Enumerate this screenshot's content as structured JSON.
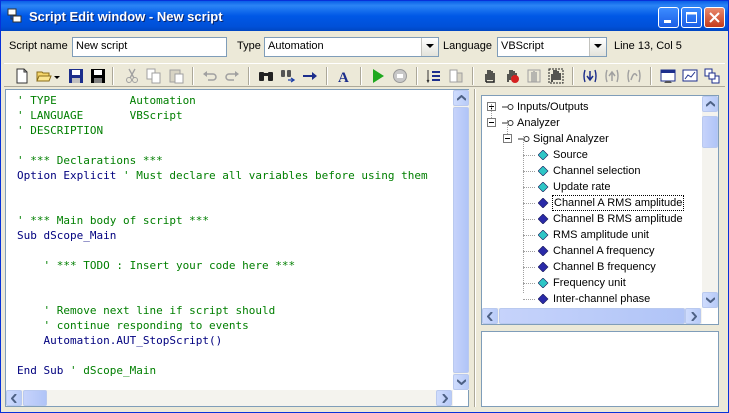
{
  "window": {
    "title": "Script Edit window - New script",
    "icon": "script-app-icon",
    "controls": [
      "minimize-icon",
      "maximize-icon",
      "close-icon"
    ]
  },
  "options": {
    "script_name_label": "Script name",
    "script_name_value": "New script",
    "type_label": "Type",
    "type_value": "Automation",
    "language_label": "Language",
    "language_value": "VBScript",
    "position_text": "Line 13, Col 5"
  },
  "toolbar": {
    "buttons": [
      "new-icon",
      "open-icon",
      "save-icon",
      "save-as-icon",
      "cut-icon",
      "copy-icon",
      "paste-icon",
      "undo-icon",
      "redo-icon",
      "find-icon",
      "replace-icon",
      "goto-icon",
      "font-icon",
      "run-icon",
      "stop-icon",
      "list-icon",
      "properties-icon",
      "hand-icon",
      "hand-stop-icon",
      "hand-grid-icon",
      "hand-events-icon",
      "step-into-icon",
      "step-over-icon",
      "step-out-icon",
      "window-icon",
      "window-chart-icon",
      "window-tiles-icon"
    ]
  },
  "code": [
    {
      "parts": [
        {
          "cls": "cmt",
          "text": "' TYPE           Automation"
        }
      ]
    },
    {
      "parts": [
        {
          "cls": "cmt",
          "text": "' LANGUAGE       VBScript"
        }
      ]
    },
    {
      "parts": [
        {
          "cls": "cmt",
          "text": "' DESCRIPTION"
        }
      ]
    },
    {
      "parts": []
    },
    {
      "parts": [
        {
          "cls": "cmt",
          "text": "' *** Declarations ***"
        }
      ]
    },
    {
      "parts": [
        {
          "cls": "kw",
          "text": "Option Explicit "
        },
        {
          "cls": "cmt",
          "text": "' Must declare all variables before using them"
        }
      ]
    },
    {
      "parts": []
    },
    {
      "parts": []
    },
    {
      "parts": [
        {
          "cls": "cmt",
          "text": "' *** Main body of script ***"
        }
      ]
    },
    {
      "parts": [
        {
          "cls": "kw",
          "text": "Sub "
        },
        {
          "cls": "obj",
          "text": "dScope_Main"
        }
      ]
    },
    {
      "parts": []
    },
    {
      "parts": [
        {
          "cls": "cmt",
          "text": "    ' *** TODO : Insert your code here ***"
        }
      ]
    },
    {
      "parts": []
    },
    {
      "parts": []
    },
    {
      "parts": [
        {
          "cls": "cmt",
          "text": "    ' Remove next line if script should"
        }
      ]
    },
    {
      "parts": [
        {
          "cls": "cmt",
          "text": "    ' continue responding to events"
        }
      ]
    },
    {
      "parts": [
        {
          "cls": "obj",
          "text": "    Automation.AUT_StopScript()"
        }
      ]
    },
    {
      "parts": []
    },
    {
      "parts": [
        {
          "cls": "kw",
          "text": "End Sub "
        },
        {
          "cls": "cmt",
          "text": "' dScope_Main"
        }
      ]
    }
  ],
  "tree": {
    "nodes": [
      {
        "label": "Inputs/Outputs",
        "level": 0,
        "kind": "group",
        "expander": "plus"
      },
      {
        "label": "Analyzer",
        "level": 0,
        "kind": "group",
        "expander": "minus"
      },
      {
        "label": "Signal Analyzer",
        "level": 1,
        "kind": "group",
        "expander": "minus"
      },
      {
        "label": "Source",
        "level": 2,
        "kind": "prop-cyan"
      },
      {
        "label": "Channel selection",
        "level": 2,
        "kind": "prop-cyan"
      },
      {
        "label": "Update rate",
        "level": 2,
        "kind": "prop-cyan"
      },
      {
        "label": "Channel A RMS amplitude",
        "level": 2,
        "kind": "prop-blue",
        "selected": true
      },
      {
        "label": "Channel B RMS amplitude",
        "level": 2,
        "kind": "prop-blue"
      },
      {
        "label": "RMS amplitude unit",
        "level": 2,
        "kind": "prop-cyan"
      },
      {
        "label": "Channel A frequency",
        "level": 2,
        "kind": "prop-blue"
      },
      {
        "label": "Channel B frequency",
        "level": 2,
        "kind": "prop-blue"
      },
      {
        "label": "Frequency unit",
        "level": 2,
        "kind": "prop-cyan"
      },
      {
        "label": "Inter-channel phase",
        "level": 2,
        "kind": "prop-blue"
      }
    ]
  },
  "colors": {
    "comment": "#007f00",
    "keyword": "#00007f",
    "title_bar": "#0058e6",
    "prop_cyan": "#2ec6c6",
    "prop_blue": "#2a2aa8"
  }
}
